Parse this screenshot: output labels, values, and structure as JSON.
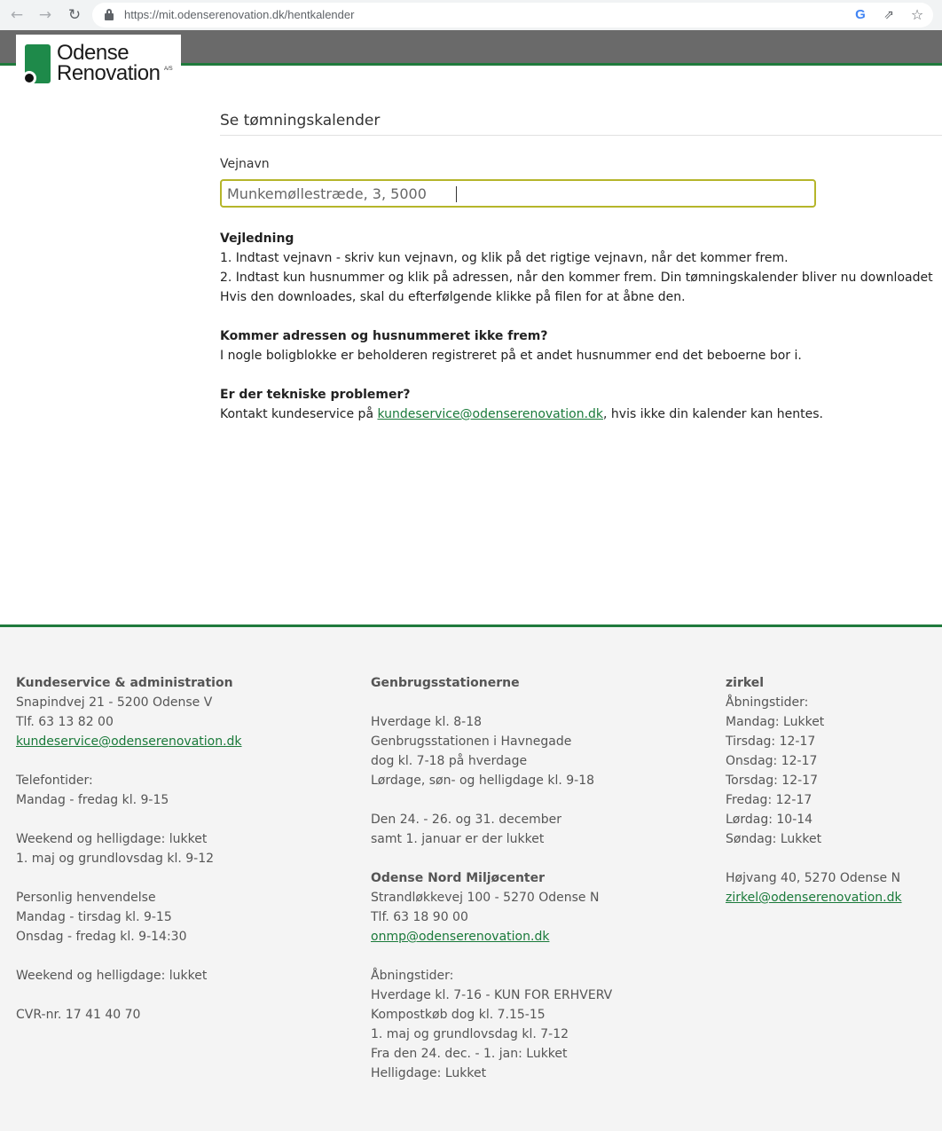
{
  "browser": {
    "url": "https://mit.odenserenovation.dk/hentkalender"
  },
  "logo": {
    "line1": "Odense",
    "line2": "Renovation",
    "suffix": "A/S",
    "brand_color": "#1e8a4a"
  },
  "main": {
    "title": "Se tømningskalender",
    "field_label": "Vejnavn",
    "field_value": "Munkemøllestræde, 3, 5000",
    "guide_heading": "Vejledning",
    "guide_lines": [
      "1. Indtast vejnavn - skriv kun vejnavn, og klik på det rigtige vejnavn, når det kommer frem.",
      "2. Indtast kun husnummer og klik på adressen, når den kommer frem. Din tømningskalender bliver nu downloadet",
      "Hvis den downloades, skal du efterfølgende klikke på filen for at åbne den."
    ],
    "address_heading": "Kommer adressen og husnummeret ikke frem?",
    "address_text": "I nogle boligblokke er beholderen registreret på et andet husnummer end det beboerne bor i.",
    "tech_heading": "Er der tekniske problemer?",
    "tech_prefix": "Kontakt kundeservice på ",
    "tech_email": "kundeservice@odenserenovation.dk",
    "tech_suffix": ", hvis ikke din kalender kan hentes."
  },
  "footer": {
    "col1": {
      "heading": "Kundeservice & administration",
      "address": "Snapindvej 21 - 5200 Odense V",
      "phone": "Tlf. 63 13 82 00",
      "email": "kundeservice@odenserenovation.dk",
      "phone_hours_label": "Telefontider:",
      "phone_hours": "Mandag - fredag kl. 9-15",
      "weekend1": "Weekend og helligdage: lukket",
      "may": "1. maj og grundlovsdag kl. 9-12",
      "personal_label": "Personlig henvendelse",
      "personal1": "Mandag - tirsdag kl. 9-15",
      "personal2": "Onsdag - fredag kl. 9-14:30",
      "weekend2": "Weekend og helligdage: lukket",
      "cvr": "CVR-nr. 17 41 40 70"
    },
    "col2": {
      "heading": "Genbrugsstationerne",
      "weekdays": "Hverdage kl. 8-18",
      "havnegade": "Genbrugsstationen i Havnegade",
      "havnegade_hours": "dog kl. 7-18 på hverdage",
      "weekend": "Lørdage, søn- og helligdage kl. 9-18",
      "dec": "Den 24. - 26. og 31. december",
      "jan": "samt 1. januar er der lukket",
      "nord_heading": "Odense Nord Miljøcenter",
      "nord_address": "Strandløkkevej 100 - 5270 Odense N",
      "nord_phone": "Tlf. 63 18 90 00",
      "nord_email": "onmp@odenserenovation.dk",
      "nord_hours_label": "Åbningstider:",
      "nord_hours1": "Hverdage kl. 7-16 - KUN FOR ERHVERV",
      "nord_hours2": "Kompostkøb dog kl. 7.15-15",
      "nord_hours3": "1. maj og grundlovsdag kl. 7-12",
      "nord_hours4": "Fra den 24. dec. - 1. jan: Lukket",
      "nord_hours5": "Helligdage: Lukket"
    },
    "col3": {
      "heading": "zirkel",
      "hours_label": "Åbningstider:",
      "days": [
        "Mandag: Lukket",
        "Tirsdag: 12-17",
        "Onsdag: 12-17",
        "Torsdag: 12-17",
        "Fredag: 12-17",
        "Lørdag: 10-14",
        "Søndag: Lukket"
      ],
      "address": "Højvang 40, 5270 Odense N",
      "email": "zirkel@odenserenovation.dk"
    }
  }
}
